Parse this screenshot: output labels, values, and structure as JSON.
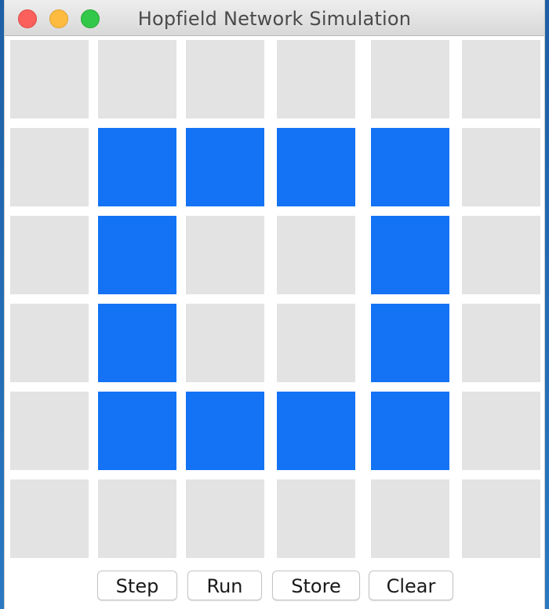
{
  "window": {
    "title": "Hopfield Network Simulation"
  },
  "colors": {
    "active_cell": "#1473f4",
    "inactive_cell": "#e3e3e3"
  },
  "grid": {
    "rows": 6,
    "cols": 6,
    "cells": [
      [
        0,
        0,
        0,
        0,
        0,
        0
      ],
      [
        0,
        1,
        1,
        1,
        1,
        0
      ],
      [
        0,
        1,
        0,
        0,
        1,
        0
      ],
      [
        0,
        1,
        0,
        0,
        1,
        0
      ],
      [
        0,
        1,
        1,
        1,
        1,
        0
      ],
      [
        0,
        0,
        0,
        0,
        0,
        0
      ]
    ]
  },
  "buttons": {
    "step": "Step",
    "run": "Run",
    "store": "Store",
    "clear": "Clear"
  }
}
